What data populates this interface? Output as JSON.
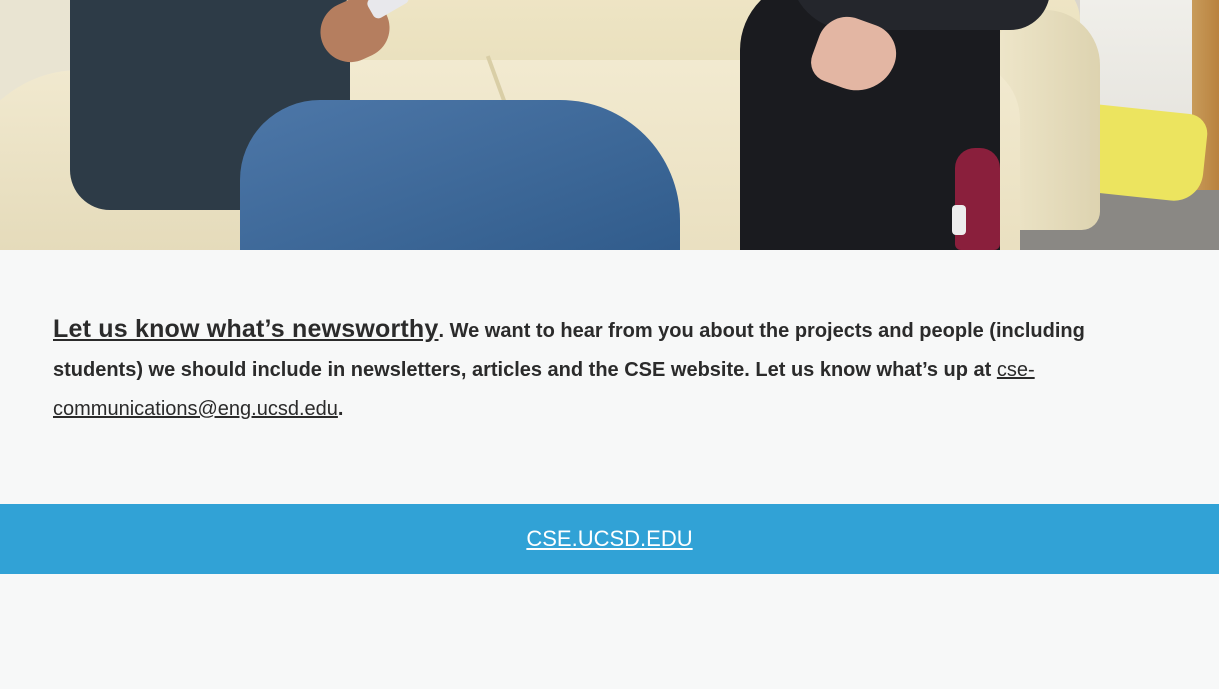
{
  "newsletter": {
    "heading_link": "Let us know what’s newsworthy",
    "body_after_heading": ". We want to hear from you about the projects and people (including students) we should include in newsletters, articles and the CSE website. Let us know what’s up at ",
    "email_link": "cse-communications@eng.ucsd.edu",
    "body_end": "."
  },
  "footer": {
    "site_link": "CSE.UCSD.EDU"
  },
  "colors": {
    "footer_bar": "#31a2d6",
    "page_background": "#f7f8f8",
    "text": "#2b2b2b"
  }
}
